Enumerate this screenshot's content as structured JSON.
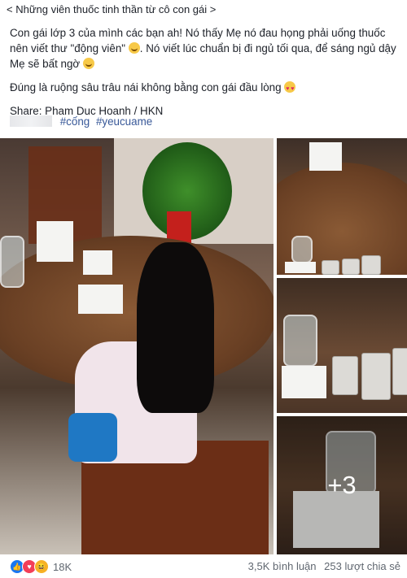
{
  "post": {
    "header": "< Những viên thuốc tinh thần từ cô con gái >",
    "p1_a": "Con gái lớp 3 của mình các bạn ah! Nó thấy Mẹ nó đau họng phải uống thuốc nên viết thư \"động viên\"",
    "p1_b": ". Nó viết lúc chuẩn bị đi ngủ tối qua, để sáng ngủ dậy Mẹ sẽ bất ngờ",
    "p2": "Đúng là ruộng sâu trâu nái không bằng con gái đầu lòng",
    "share": "Share: Pham Duc Hoanh / HKN",
    "hashtags": [
      "#cống",
      "#yeucuame"
    ]
  },
  "media": {
    "more_count": "+3"
  },
  "footer": {
    "reaction_count": "18K",
    "comments": "3,5K bình luận",
    "shares": "253 lượt chia sẻ"
  },
  "icons": [
    "like-reaction-icon",
    "love-reaction-icon",
    "haha-reaction-icon",
    "smile-emoji-icon",
    "heart-eyes-emoji-icon"
  ]
}
